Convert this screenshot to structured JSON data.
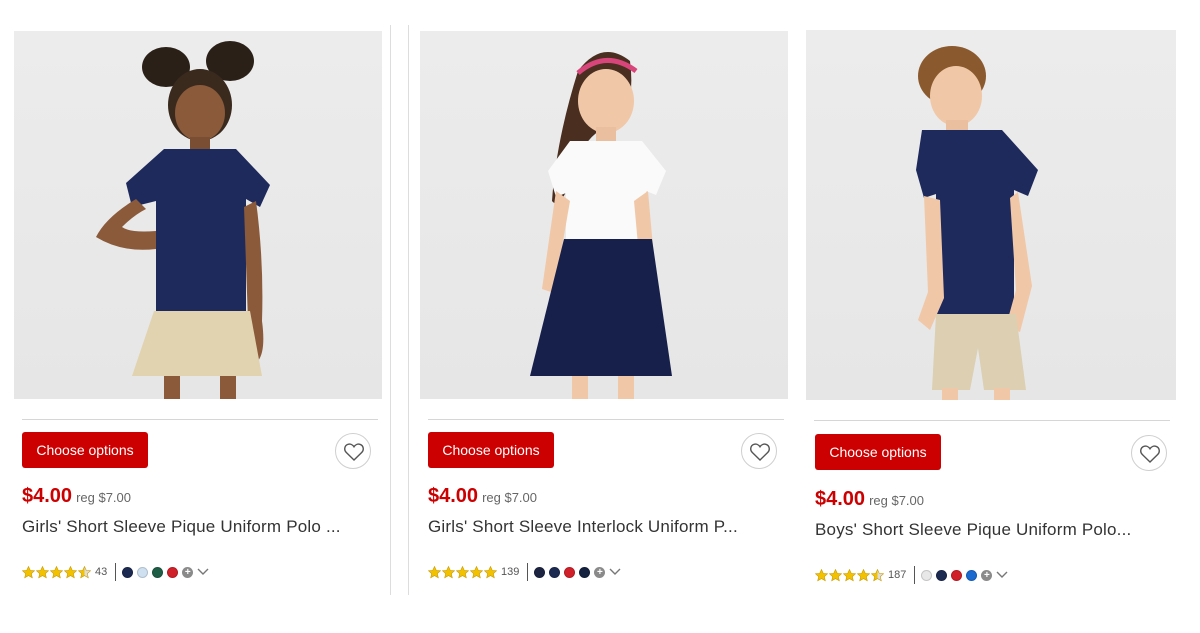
{
  "colors": {
    "accent": "#cc0000",
    "star": "#f2c200"
  },
  "products": [
    {
      "choose_label": "Choose options",
      "price": "$4.00",
      "reg": "reg $7.00",
      "title": "Girls' Short Sleeve Pique Uniform Polo ...",
      "rating": 4.5,
      "reviews": "43",
      "swatches": [
        "#1c2a52",
        "#cfe0f0",
        "#1f5e46",
        "#d0202a"
      ],
      "more_icon": "plus-circle-icon",
      "expand_icon": "chevron-down-icon"
    },
    {
      "choose_label": "Choose options",
      "price": "$4.00",
      "reg": "reg $7.00",
      "title": "Girls' Short Sleeve Interlock Uniform P...",
      "rating": 5,
      "reviews": "139",
      "swatches": [
        "#1c2442",
        "#1c2a52",
        "#d0202a",
        "#14213f"
      ],
      "more_icon": "plus-circle-icon",
      "expand_icon": "chevron-down-icon"
    },
    {
      "choose_label": "Choose options",
      "price": "$4.00",
      "reg": "reg $7.00",
      "title": "Boys' Short Sleeve Pique Uniform Polo...",
      "rating": 4.5,
      "reviews": "187",
      "swatches": [
        "#e8e8e8",
        "#1c2a52",
        "#d0202a",
        "#1a6ad0"
      ],
      "more_icon": "plus-circle-icon",
      "expand_icon": "chevron-down-icon"
    }
  ]
}
